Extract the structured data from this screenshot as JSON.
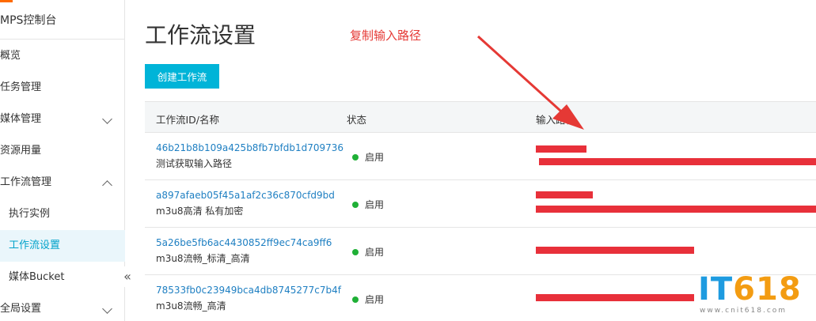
{
  "sidebar": {
    "title": "MPS控制台",
    "items": [
      {
        "label": "概览"
      },
      {
        "label": "任务管理"
      },
      {
        "label": "媒体管理"
      },
      {
        "label": "资源用量"
      },
      {
        "label": "工作流管理"
      },
      {
        "label": "执行实例"
      },
      {
        "label": "工作流设置"
      },
      {
        "label": "媒体Bucket"
      },
      {
        "label": "全局设置"
      }
    ],
    "collapse_glyph": "«"
  },
  "page": {
    "title": "工作流设置",
    "annotation": "复制输入路径",
    "create_button": "创建工作流"
  },
  "table": {
    "headers": [
      "工作流ID/名称",
      "状态",
      "输入路径"
    ],
    "rows": [
      {
        "id": "46b21b8b109a425b8fb7bfdb1d709736",
        "name": "测试获取输入路径",
        "status": "启用"
      },
      {
        "id": "a897afaeb05f45a1af2c36c870cfd9bd",
        "name": "m3u8高清 私有加密",
        "status": "启用"
      },
      {
        "id": "5a26be5fb6ac4430852ff9ec74ca9ff6",
        "name": "m3u8流畅_标清_高清",
        "status": "启用"
      },
      {
        "id": "78533fb0c23949bca4db8745277c7b4f",
        "name": "m3u8流畅_高清",
        "status": "启用"
      }
    ]
  },
  "watermark": {
    "logo_blue": "IT",
    "logo_orange": "618",
    "url": "www.cnit618.com"
  },
  "colors": {
    "accent": "#00b4d8",
    "link": "#1e7fc2",
    "status_on": "#1fb036",
    "annotation": "#e53935"
  }
}
